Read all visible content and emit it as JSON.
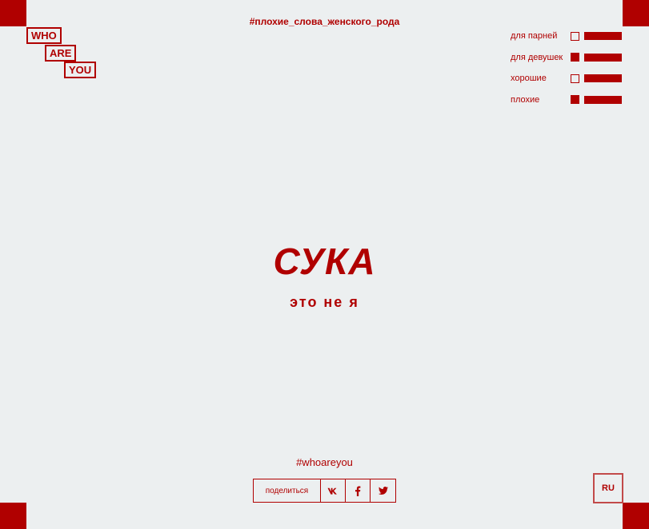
{
  "logo": {
    "line1": "WHO",
    "line2": "ARE",
    "line3": "YOU"
  },
  "header": {
    "hashtag": "#плохие_слова_женского_рода"
  },
  "filters": [
    {
      "label": "для парней",
      "checked": false
    },
    {
      "label": "для девушек",
      "checked": true
    },
    {
      "label": "хорошие",
      "checked": false
    },
    {
      "label": "плохие",
      "checked": true
    }
  ],
  "hero": {
    "word": "СУКА",
    "subtitle": "это не я"
  },
  "footer": {
    "hashtag": "#whoareyou",
    "share_label": "поделиться",
    "vk_label": "vk",
    "fb_label": "f",
    "tw_label": "t"
  },
  "lang": {
    "current": "RU"
  },
  "colors": {
    "accent": "#b00000",
    "background": "#eceff0"
  },
  "icons": {
    "vk": "vk-icon",
    "facebook": "facebook-icon",
    "twitter": "twitter-icon"
  }
}
